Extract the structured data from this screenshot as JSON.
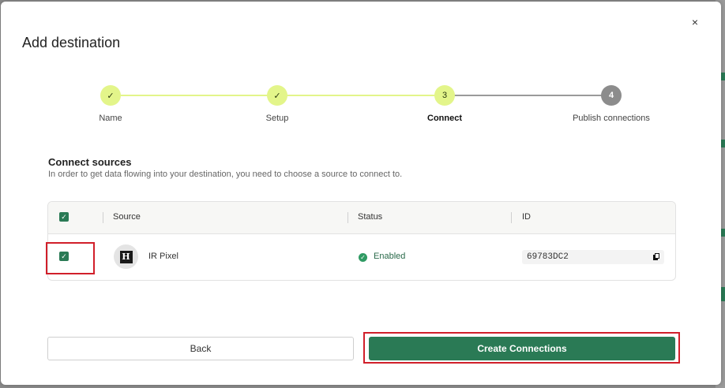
{
  "modal": {
    "title": "Add destination",
    "close_glyph": "×"
  },
  "stepper": {
    "steps": [
      {
        "label": "Name",
        "state": "done",
        "marker": "✓"
      },
      {
        "label": "Setup",
        "state": "done",
        "marker": "✓"
      },
      {
        "label": "Connect",
        "state": "current",
        "marker": "3"
      },
      {
        "label": "Publish connections",
        "state": "pending",
        "marker": "4"
      }
    ]
  },
  "section": {
    "title": "Connect sources",
    "subtitle": "In order to get data flowing into your destination, you need to choose a source to connect to."
  },
  "table": {
    "headers": {
      "source": "Source",
      "status": "Status",
      "id": "ID"
    },
    "rows": [
      {
        "checked": true,
        "avatar_letter": "H",
        "source": "IR Pixel",
        "status": "Enabled",
        "id": "69783DC2"
      }
    ]
  },
  "buttons": {
    "back": "Back",
    "create": "Create Connections"
  },
  "colors": {
    "accent": "#2a7a55",
    "step_done": "#e3f58a",
    "step_pending": "#8c8c8c",
    "highlight": "#d11f2a"
  },
  "icons": {
    "check": "check-icon",
    "copy": "copy-icon",
    "close": "close-icon",
    "status": "check-circle-icon"
  }
}
